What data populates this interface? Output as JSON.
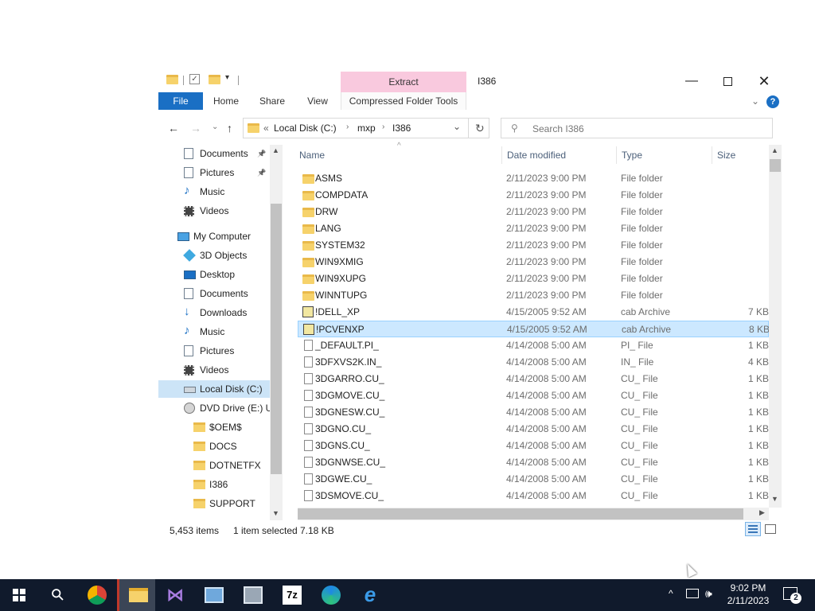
{
  "window": {
    "ribbon_context_label": "Extract",
    "title": "I386",
    "tabs": [
      "File",
      "Home",
      "Share",
      "View",
      "Compressed Folder Tools"
    ]
  },
  "address": {
    "chevrons": "«",
    "crumbs": [
      "Local Disk (C:)",
      "mxp",
      "I386"
    ],
    "search_placeholder": "Search I386"
  },
  "nav": [
    {
      "label": "Documents",
      "icon": "documents-icon",
      "pinned": true,
      "selected": false
    },
    {
      "label": "Pictures",
      "icon": "pictures-icon",
      "pinned": true,
      "selected": false
    },
    {
      "label": "Music",
      "icon": "music-icon",
      "pinned": false,
      "selected": false
    },
    {
      "label": "Videos",
      "icon": "videos-icon",
      "pinned": false,
      "selected": false
    },
    {
      "label": "My Computer",
      "icon": "computer-icon",
      "pinned": false,
      "selected": false
    },
    {
      "label": "3D Objects",
      "icon": "3d-objects-icon",
      "pinned": false,
      "selected": false
    },
    {
      "label": "Desktop",
      "icon": "desktop-icon",
      "pinned": false,
      "selected": false
    },
    {
      "label": "Documents",
      "icon": "documents-icon",
      "pinned": false,
      "selected": false
    },
    {
      "label": "Downloads",
      "icon": "downloads-icon",
      "pinned": false,
      "selected": false
    },
    {
      "label": "Music",
      "icon": "music-icon",
      "pinned": false,
      "selected": false
    },
    {
      "label": "Pictures",
      "icon": "pictures-icon",
      "pinned": false,
      "selected": false
    },
    {
      "label": "Videos",
      "icon": "videos-icon",
      "pinned": false,
      "selected": false
    },
    {
      "label": "Local Disk (C:)",
      "icon": "drive-icon",
      "pinned": false,
      "selected": true
    },
    {
      "label": "DVD Drive (E:) UI",
      "icon": "dvd-drive-icon",
      "pinned": false,
      "selected": false
    },
    {
      "label": "$OEM$",
      "icon": "folder-icon",
      "pinned": false,
      "selected": false
    },
    {
      "label": "DOCS",
      "icon": "folder-icon",
      "pinned": false,
      "selected": false
    },
    {
      "label": "DOTNETFX",
      "icon": "folder-icon",
      "pinned": false,
      "selected": false
    },
    {
      "label": "I386",
      "icon": "folder-icon",
      "pinned": false,
      "selected": false
    },
    {
      "label": "SUPPORT",
      "icon": "folder-icon",
      "pinned": false,
      "selected": false
    }
  ],
  "columns": {
    "name": "Name",
    "date": "Date modified",
    "type": "Type",
    "size": "Size"
  },
  "files": [
    {
      "name": "ASMS",
      "date": "2/11/2023 9:00 PM",
      "type": "File folder",
      "size": "",
      "kind": "folder"
    },
    {
      "name": "COMPDATA",
      "date": "2/11/2023 9:00 PM",
      "type": "File folder",
      "size": "",
      "kind": "folder"
    },
    {
      "name": "DRW",
      "date": "2/11/2023 9:00 PM",
      "type": "File folder",
      "size": "",
      "kind": "folder"
    },
    {
      "name": "LANG",
      "date": "2/11/2023 9:00 PM",
      "type": "File folder",
      "size": "",
      "kind": "folder"
    },
    {
      "name": "SYSTEM32",
      "date": "2/11/2023 9:00 PM",
      "type": "File folder",
      "size": "",
      "kind": "folder"
    },
    {
      "name": "WIN9XMIG",
      "date": "2/11/2023 9:00 PM",
      "type": "File folder",
      "size": "",
      "kind": "folder"
    },
    {
      "name": "WIN9XUPG",
      "date": "2/11/2023 9:00 PM",
      "type": "File folder",
      "size": "",
      "kind": "folder"
    },
    {
      "name": "WINNTUPG",
      "date": "2/11/2023 9:00 PM",
      "type": "File folder",
      "size": "",
      "kind": "folder"
    },
    {
      "name": "!DELL_XP",
      "date": "4/15/2005 9:52 AM",
      "type": "cab Archive",
      "size": "7 KB",
      "kind": "cab"
    },
    {
      "name": "!PCVENXP",
      "date": "4/15/2005 9:52 AM",
      "type": "cab Archive",
      "size": "8 KB",
      "kind": "cab",
      "selected": true
    },
    {
      "name": "_DEFAULT.PI_",
      "date": "4/14/2008 5:00 AM",
      "type": "PI_ File",
      "size": "1 KB",
      "kind": "file"
    },
    {
      "name": "3DFXVS2K.IN_",
      "date": "4/14/2008 5:00 AM",
      "type": "IN_ File",
      "size": "4 KB",
      "kind": "file"
    },
    {
      "name": "3DGARRO.CU_",
      "date": "4/14/2008 5:00 AM",
      "type": "CU_ File",
      "size": "1 KB",
      "kind": "file"
    },
    {
      "name": "3DGMOVE.CU_",
      "date": "4/14/2008 5:00 AM",
      "type": "CU_ File",
      "size": "1 KB",
      "kind": "file"
    },
    {
      "name": "3DGNESW.CU_",
      "date": "4/14/2008 5:00 AM",
      "type": "CU_ File",
      "size": "1 KB",
      "kind": "file"
    },
    {
      "name": "3DGNO.CU_",
      "date": "4/14/2008 5:00 AM",
      "type": "CU_ File",
      "size": "1 KB",
      "kind": "file"
    },
    {
      "name": "3DGNS.CU_",
      "date": "4/14/2008 5:00 AM",
      "type": "CU_ File",
      "size": "1 KB",
      "kind": "file"
    },
    {
      "name": "3DGNWSE.CU_",
      "date": "4/14/2008 5:00 AM",
      "type": "CU_ File",
      "size": "1 KB",
      "kind": "file"
    },
    {
      "name": "3DGWE.CU_",
      "date": "4/14/2008 5:00 AM",
      "type": "CU_ File",
      "size": "1 KB",
      "kind": "file"
    },
    {
      "name": "3DSMOVE.CU_",
      "date": "4/14/2008 5:00 AM",
      "type": "CU_ File",
      "size": "1 KB",
      "kind": "file"
    }
  ],
  "status": {
    "items": "5,453 items",
    "selected": "1 item selected",
    "size": "7.18 KB"
  },
  "taskbar": {
    "apps": [
      {
        "icon": "start-windows-icon"
      },
      {
        "icon": "search-icon"
      },
      {
        "icon": "chrome-icon"
      },
      {
        "icon": "file-explorer-icon",
        "active": true
      },
      {
        "icon": "visual-studio-icon"
      },
      {
        "icon": "control-panel-icon"
      },
      {
        "icon": "tools-icon"
      },
      {
        "icon": "7zip-icon",
        "text": "7z"
      },
      {
        "icon": "edge-icon"
      },
      {
        "icon": "internet-explorer-icon"
      }
    ],
    "time": "9:02 PM",
    "date": "2/11/2023",
    "notification_count": "2"
  },
  "colors": {
    "accent": "#1a6fc4",
    "context_tab": "#f9c9de",
    "selection": "#cce8ff",
    "taskbar": "#101a2c"
  }
}
